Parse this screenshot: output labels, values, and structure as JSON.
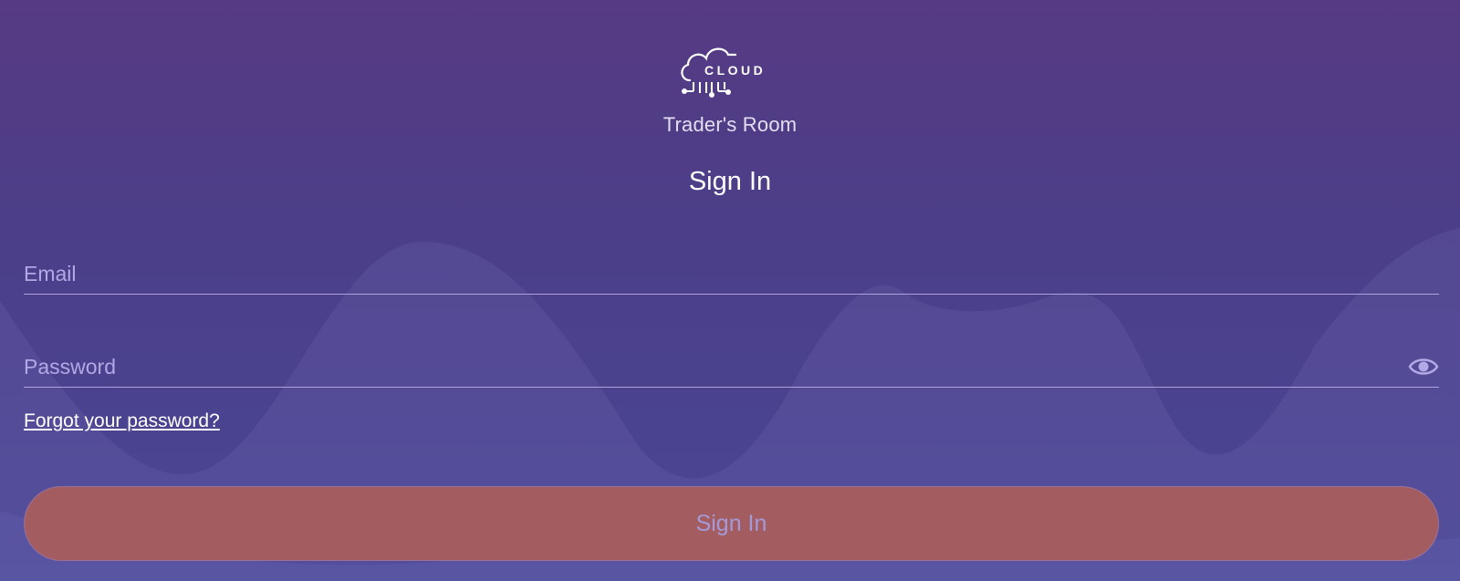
{
  "brand": {
    "logo_text": "CLOUD",
    "logo_icon": "cloud-circuit-icon",
    "subtitle": "Trader's Room"
  },
  "form": {
    "heading": "Sign In",
    "email": {
      "placeholder": "Email",
      "value": ""
    },
    "password": {
      "placeholder": "Password",
      "value": "",
      "toggle_icon": "eye-icon"
    },
    "forgot_link": "Forgot your password?",
    "submit_label": "Sign In"
  },
  "colors": {
    "background_top": "#563a83",
    "background_bottom": "#4a4795",
    "button": "#a35d61",
    "button_text": "#a49ad9",
    "placeholder": "#b3a8e6"
  }
}
